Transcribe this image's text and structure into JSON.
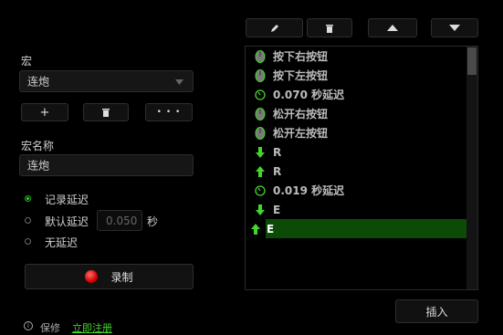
{
  "toolbar": {
    "edit_icon": "pencil-icon",
    "delete_icon": "trash-icon",
    "up_icon": "triangle-up-icon",
    "down_icon": "triangle-down-icon"
  },
  "macro": {
    "label": "宏",
    "selected": "连炮",
    "add_label": "+",
    "more_label": "• • •"
  },
  "macro_name": {
    "label": "宏名称",
    "value": "连炮"
  },
  "delay_options": {
    "record": "记录延迟",
    "default": "默认延迟",
    "default_value": "0.050",
    "unit": "秒",
    "none": "无延迟",
    "selected": "record"
  },
  "record_button": {
    "label": "录制"
  },
  "footer": {
    "save": "保修",
    "register": "立即注册"
  },
  "events": [
    {
      "type": "mouse",
      "text": "按下右按钮"
    },
    {
      "type": "mouse",
      "text": "按下左按钮"
    },
    {
      "type": "delay",
      "text": "0.070 秒延迟"
    },
    {
      "type": "mouse",
      "text": "松开右按钮"
    },
    {
      "type": "mouse",
      "text": "松开左按钮"
    },
    {
      "type": "key-down",
      "text": "R"
    },
    {
      "type": "key-up",
      "text": "R"
    },
    {
      "type": "delay",
      "text": "0.019 秒延迟"
    },
    {
      "type": "key-down",
      "text": "E"
    },
    {
      "type": "key-up",
      "text": "E",
      "selected": true
    }
  ],
  "insert_button": {
    "label": "插入"
  },
  "colors": {
    "accent": "#44d62c",
    "selection": "#0b4a07"
  }
}
